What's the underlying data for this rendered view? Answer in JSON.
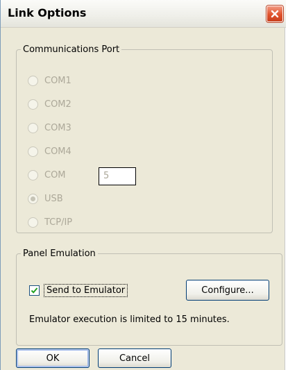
{
  "window": {
    "title": "Link Options"
  },
  "communications_port": {
    "legend": "Communications Port",
    "options": [
      {
        "label": "COM1",
        "selected": false,
        "enabled": false
      },
      {
        "label": "COM2",
        "selected": false,
        "enabled": false
      },
      {
        "label": "COM3",
        "selected": false,
        "enabled": false
      },
      {
        "label": "COM4",
        "selected": false,
        "enabled": false
      },
      {
        "label": "COM",
        "selected": false,
        "enabled": false
      },
      {
        "label": "USB",
        "selected": true,
        "enabled": false
      },
      {
        "label": "TCP/IP",
        "selected": false,
        "enabled": false
      }
    ],
    "com_number_value": "5"
  },
  "panel_emulation": {
    "legend": "Panel Emulation",
    "send_to_emulator_label": "Send to Emulator",
    "send_to_emulator_checked": true,
    "configure_label": "Configure...",
    "limit_message": "Emulator execution is limited to 15 minutes."
  },
  "footer": {
    "ok_label": "OK",
    "cancel_label": "Cancel"
  },
  "colors": {
    "dialog_bg": "#ece9d8",
    "disabled_text": "#aca899",
    "close_button": "#e0522c",
    "checkmark": "#21a121"
  },
  "icons": {
    "close": "close-icon",
    "check": "checkmark-icon"
  }
}
